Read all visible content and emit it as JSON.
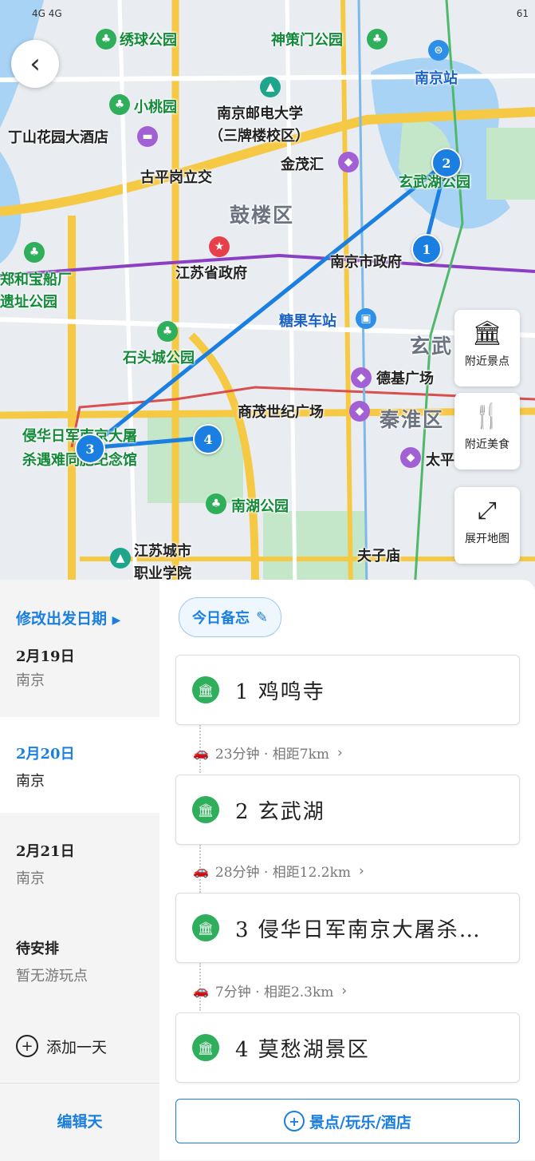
{
  "status_bar": {
    "left": "4G 4G",
    "right": "61"
  },
  "map": {
    "labels": {
      "xiuqiu": "绣球公园",
      "shence": "神策门公园",
      "nanjing_station": "南京站",
      "xiaotao": "小桃园",
      "njupt_1": "南京邮电大学",
      "njupt_2": "（三牌楼校区）",
      "dingshan": "丁山花园大酒店",
      "jinmao": "金茂汇",
      "guping": "古平岗立交",
      "xuanwu_park": "玄武湖公园",
      "gulou": "鼓楼区",
      "zhenghe_1": "郑和宝船厂",
      "zhenghe_2": "遗址公园",
      "jiangsu_gov": "江苏省政府",
      "nanjing_gov": "南京市政府",
      "tangguo": "糖果车站",
      "shitou": "石头城公园",
      "xuanwu_district": "玄武",
      "deji": "德基广场",
      "maochen": "商茂世纪广场",
      "qinhuai": "秦淮区",
      "memorial_1": "侵华日军南京大屠",
      "memorial_2": "杀遇难同胞纪念馆",
      "taiping": "太平",
      "nanhu": "南湖公园",
      "jscity_1": "江苏城市",
      "jscity_2": "职业学院",
      "fuzimiao": "夫子庙"
    },
    "markers": [
      "1",
      "2",
      "3",
      "4"
    ],
    "side_buttons": {
      "scenic": "附近景点",
      "food": "附近美食",
      "expand": "展开地图"
    }
  },
  "sidebar": {
    "edit_date": "修改出发日期",
    "days": [
      {
        "date": "2月19日",
        "city": "南京"
      },
      {
        "date": "2月20日",
        "city": "南京"
      },
      {
        "date": "2月21日",
        "city": "南京"
      },
      {
        "date": "待安排",
        "city": "暂无游玩点"
      }
    ],
    "add_day": "添加一天",
    "edit_days": "编辑天"
  },
  "itinerary": {
    "memo": "今日备忘",
    "stops": [
      {
        "name": "1 鸡鸣寺"
      },
      {
        "name": "2 玄武湖"
      },
      {
        "name": "3 侵华日军南京大屠杀…"
      },
      {
        "name": "4 莫愁湖景区"
      }
    ],
    "legs": [
      "23分钟 · 相距7km",
      "28分钟 · 相距12.2km",
      "7分钟 · 相距2.3km"
    ],
    "add_button": "景点/玩乐/酒店"
  },
  "colors": {
    "accent": "#1a7fe0",
    "route": "#1a7fe0",
    "park": "#2fae5b"
  }
}
